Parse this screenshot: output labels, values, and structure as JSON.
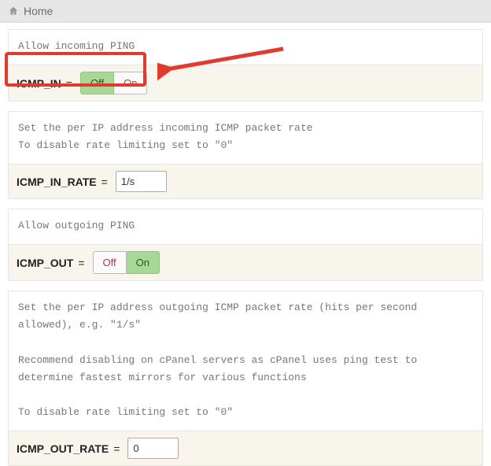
{
  "header": {
    "home_label": "Home"
  },
  "sections": {
    "icmp_in": {
      "desc": "Allow incoming PING",
      "label": "ICMP_IN",
      "off": "Off",
      "on": "On",
      "selected": "off"
    },
    "icmp_in_rate": {
      "desc": "Set the per IP address incoming ICMP packet rate\nTo disable rate limiting set to \"0\"",
      "label": "ICMP_IN_RATE",
      "value": "1/s"
    },
    "icmp_out": {
      "desc": "Allow outgoing PING",
      "label": "ICMP_OUT",
      "off": "Off",
      "on": "On",
      "selected": "on"
    },
    "icmp_out_rate": {
      "desc": "Set the per IP address outgoing ICMP packet rate (hits per second allowed), e.g. \"1/s\"\n\nRecommend disabling on cPanel servers as cPanel uses ping test to determine fastest mirrors for various functions\n\nTo disable rate limiting set to \"0\"",
      "label": "ICMP_OUT_RATE",
      "value": "0"
    }
  },
  "annotation": {
    "color": "#e03b2f"
  }
}
